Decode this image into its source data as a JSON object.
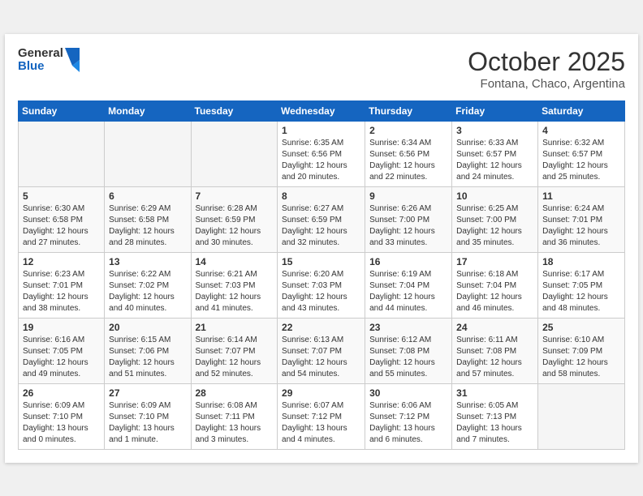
{
  "header": {
    "logo_line1": "General",
    "logo_line2": "Blue",
    "month": "October 2025",
    "location": "Fontana, Chaco, Argentina"
  },
  "weekdays": [
    "Sunday",
    "Monday",
    "Tuesday",
    "Wednesday",
    "Thursday",
    "Friday",
    "Saturday"
  ],
  "weeks": [
    [
      {
        "day": "",
        "info": ""
      },
      {
        "day": "",
        "info": ""
      },
      {
        "day": "",
        "info": ""
      },
      {
        "day": "1",
        "info": "Sunrise: 6:35 AM\nSunset: 6:56 PM\nDaylight: 12 hours\nand 20 minutes."
      },
      {
        "day": "2",
        "info": "Sunrise: 6:34 AM\nSunset: 6:56 PM\nDaylight: 12 hours\nand 22 minutes."
      },
      {
        "day": "3",
        "info": "Sunrise: 6:33 AM\nSunset: 6:57 PM\nDaylight: 12 hours\nand 24 minutes."
      },
      {
        "day": "4",
        "info": "Sunrise: 6:32 AM\nSunset: 6:57 PM\nDaylight: 12 hours\nand 25 minutes."
      }
    ],
    [
      {
        "day": "5",
        "info": "Sunrise: 6:30 AM\nSunset: 6:58 PM\nDaylight: 12 hours\nand 27 minutes."
      },
      {
        "day": "6",
        "info": "Sunrise: 6:29 AM\nSunset: 6:58 PM\nDaylight: 12 hours\nand 28 minutes."
      },
      {
        "day": "7",
        "info": "Sunrise: 6:28 AM\nSunset: 6:59 PM\nDaylight: 12 hours\nand 30 minutes."
      },
      {
        "day": "8",
        "info": "Sunrise: 6:27 AM\nSunset: 6:59 PM\nDaylight: 12 hours\nand 32 minutes."
      },
      {
        "day": "9",
        "info": "Sunrise: 6:26 AM\nSunset: 7:00 PM\nDaylight: 12 hours\nand 33 minutes."
      },
      {
        "day": "10",
        "info": "Sunrise: 6:25 AM\nSunset: 7:00 PM\nDaylight: 12 hours\nand 35 minutes."
      },
      {
        "day": "11",
        "info": "Sunrise: 6:24 AM\nSunset: 7:01 PM\nDaylight: 12 hours\nand 36 minutes."
      }
    ],
    [
      {
        "day": "12",
        "info": "Sunrise: 6:23 AM\nSunset: 7:01 PM\nDaylight: 12 hours\nand 38 minutes."
      },
      {
        "day": "13",
        "info": "Sunrise: 6:22 AM\nSunset: 7:02 PM\nDaylight: 12 hours\nand 40 minutes."
      },
      {
        "day": "14",
        "info": "Sunrise: 6:21 AM\nSunset: 7:03 PM\nDaylight: 12 hours\nand 41 minutes."
      },
      {
        "day": "15",
        "info": "Sunrise: 6:20 AM\nSunset: 7:03 PM\nDaylight: 12 hours\nand 43 minutes."
      },
      {
        "day": "16",
        "info": "Sunrise: 6:19 AM\nSunset: 7:04 PM\nDaylight: 12 hours\nand 44 minutes."
      },
      {
        "day": "17",
        "info": "Sunrise: 6:18 AM\nSunset: 7:04 PM\nDaylight: 12 hours\nand 46 minutes."
      },
      {
        "day": "18",
        "info": "Sunrise: 6:17 AM\nSunset: 7:05 PM\nDaylight: 12 hours\nand 48 minutes."
      }
    ],
    [
      {
        "day": "19",
        "info": "Sunrise: 6:16 AM\nSunset: 7:05 PM\nDaylight: 12 hours\nand 49 minutes."
      },
      {
        "day": "20",
        "info": "Sunrise: 6:15 AM\nSunset: 7:06 PM\nDaylight: 12 hours\nand 51 minutes."
      },
      {
        "day": "21",
        "info": "Sunrise: 6:14 AM\nSunset: 7:07 PM\nDaylight: 12 hours\nand 52 minutes."
      },
      {
        "day": "22",
        "info": "Sunrise: 6:13 AM\nSunset: 7:07 PM\nDaylight: 12 hours\nand 54 minutes."
      },
      {
        "day": "23",
        "info": "Sunrise: 6:12 AM\nSunset: 7:08 PM\nDaylight: 12 hours\nand 55 minutes."
      },
      {
        "day": "24",
        "info": "Sunrise: 6:11 AM\nSunset: 7:08 PM\nDaylight: 12 hours\nand 57 minutes."
      },
      {
        "day": "25",
        "info": "Sunrise: 6:10 AM\nSunset: 7:09 PM\nDaylight: 12 hours\nand 58 minutes."
      }
    ],
    [
      {
        "day": "26",
        "info": "Sunrise: 6:09 AM\nSunset: 7:10 PM\nDaylight: 13 hours\nand 0 minutes."
      },
      {
        "day": "27",
        "info": "Sunrise: 6:09 AM\nSunset: 7:10 PM\nDaylight: 13 hours\nand 1 minute."
      },
      {
        "day": "28",
        "info": "Sunrise: 6:08 AM\nSunset: 7:11 PM\nDaylight: 13 hours\nand 3 minutes."
      },
      {
        "day": "29",
        "info": "Sunrise: 6:07 AM\nSunset: 7:12 PM\nDaylight: 13 hours\nand 4 minutes."
      },
      {
        "day": "30",
        "info": "Sunrise: 6:06 AM\nSunset: 7:12 PM\nDaylight: 13 hours\nand 6 minutes."
      },
      {
        "day": "31",
        "info": "Sunrise: 6:05 AM\nSunset: 7:13 PM\nDaylight: 13 hours\nand 7 minutes."
      },
      {
        "day": "",
        "info": ""
      }
    ]
  ]
}
